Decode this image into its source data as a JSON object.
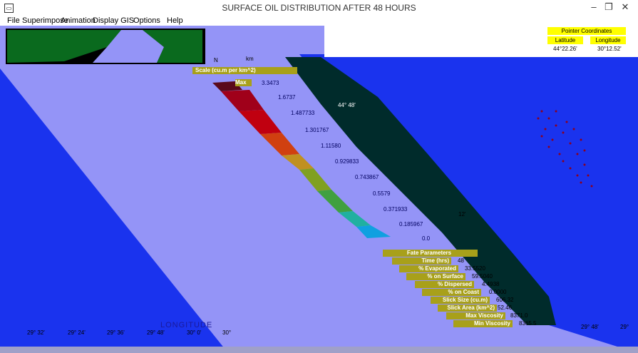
{
  "window": {
    "title": "SURFACE OIL DISTRIBUTION AFTER 48 HOURS"
  },
  "menu": [
    "File",
    "Superimpose",
    "Animation",
    "Display GIS",
    "Options",
    "Help"
  ],
  "pointer": {
    "title": "Pointer Coordinates",
    "lat_label": "Latitude",
    "lon_label": "Longitude",
    "lat": "44°22.26'",
    "lon": "30°12.52'"
  },
  "scale": {
    "title": "Scale (cu.m per km^2)",
    "max_label": "Max",
    "values": [
      "3.3473",
      "1.6737",
      "1.487733",
      "1.301767",
      "1.11580",
      "0.929833",
      "0.743867",
      "0.5579",
      "0.371933",
      "0.185967",
      "0.0"
    ]
  },
  "fate": {
    "title": "Fate Parameters",
    "rows": [
      {
        "label": "Time (hrs)",
        "value": "48"
      },
      {
        "label": "% Evaporated",
        "value": "33.5520"
      },
      {
        "label": "% on Surface",
        "value": "59.5040"
      },
      {
        "label": "% Dispersed",
        "value": "4.4938"
      },
      {
        "label": "% on Coast",
        "value": "0.0000"
      },
      {
        "label": "Slick Size (cu.m)",
        "value": "606.32"
      },
      {
        "label": "Slick Area (km^2)",
        "value": "52.46"
      },
      {
        "label": "Max Viscosity",
        "value": "8371.0"
      },
      {
        "label": "Min Viscosity",
        "value": "8365.5"
      }
    ]
  },
  "axis": {
    "label": "LONGITUDE",
    "ticks": [
      "29° 32'",
      "29° 24'",
      "29° 36'",
      "29° 48'",
      "30° 0'",
      "30°"
    ],
    "right_ticks": [
      "29° 48'",
      "29°"
    ],
    "map_labels": [
      "44° 48'",
      "12'",
      "N",
      "km"
    ]
  },
  "colors": {
    "sea": "#9494f7",
    "deep_sea": "#1a33ee",
    "land": "#0a6a1e",
    "coast": "#002b2b",
    "panel": "#a8a01a",
    "highlight": "#ffff00"
  }
}
